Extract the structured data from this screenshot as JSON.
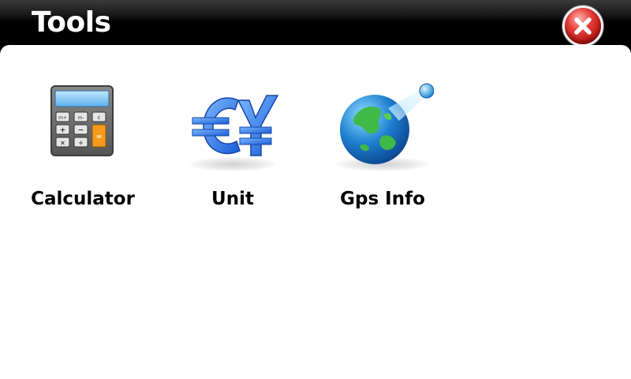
{
  "window": {
    "title": "Tools",
    "close_icon": "close-icon",
    "accent_colors": {
      "close": "#d42a26",
      "title_bar": "#000000",
      "content_bg": "#ffffff"
    }
  },
  "tools": [
    {
      "label": "Calculator",
      "icon": "calculator-icon"
    },
    {
      "label": "Unit",
      "icon": "currency-conversion-icon"
    },
    {
      "label": "Gps Info",
      "icon": "globe-satellite-icon"
    }
  ],
  "calculator_keys": [
    "m+",
    "m-",
    "c",
    "+",
    "−",
    "×",
    "÷",
    "="
  ]
}
